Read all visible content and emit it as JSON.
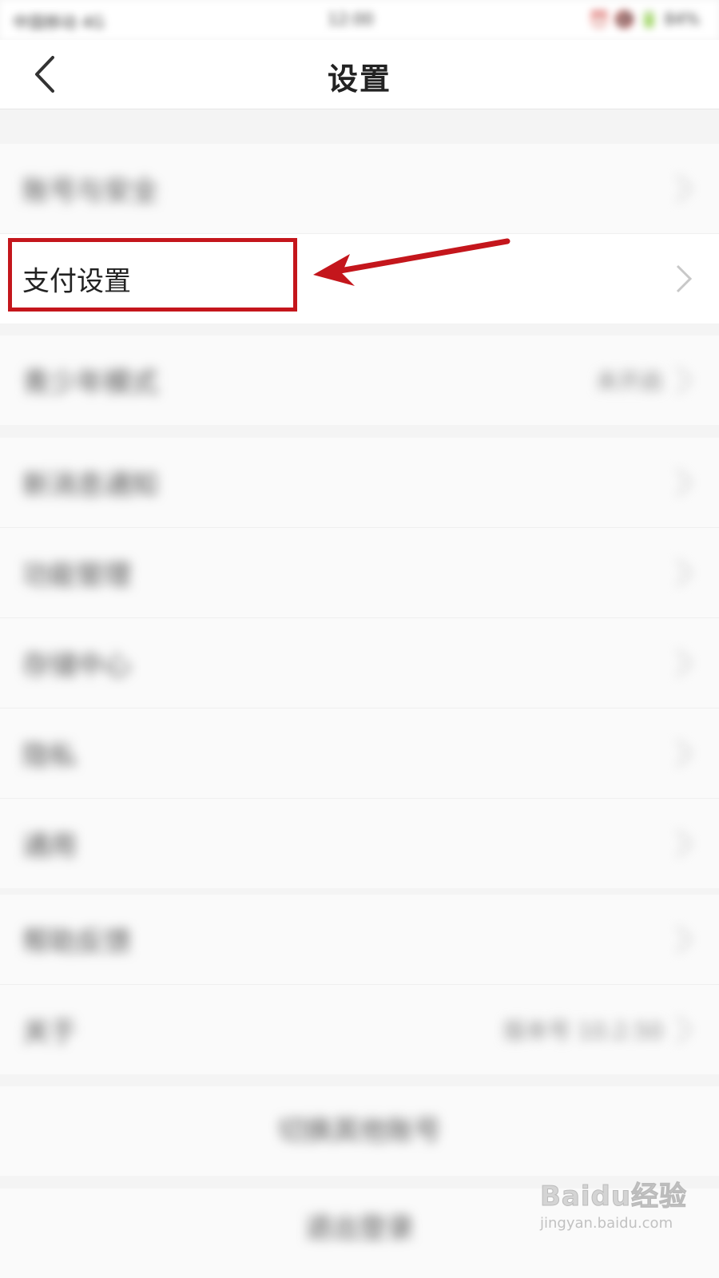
{
  "status_bar": {
    "left": "中国移动 4G",
    "time": "12:00",
    "right": "⏰ 🔇 🔋 84%"
  },
  "nav": {
    "title": "设置"
  },
  "sections": [
    {
      "rows": [
        {
          "label": "账号与安全",
          "value": "",
          "highlighted": false
        },
        {
          "label": "支付设置",
          "value": "",
          "highlighted": true
        }
      ]
    },
    {
      "rows": [
        {
          "label": "青少年模式",
          "value": "未开启",
          "highlighted": false
        }
      ]
    },
    {
      "rows": [
        {
          "label": "新消息通知",
          "value": ""
        },
        {
          "label": "功能管理",
          "value": ""
        },
        {
          "label": "存储中心",
          "value": ""
        },
        {
          "label": "隐私",
          "value": ""
        },
        {
          "label": "通用",
          "value": ""
        }
      ]
    },
    {
      "rows": [
        {
          "label": "帮助反馈",
          "value": ""
        },
        {
          "label": "关于",
          "value": "版本号 10.2.50"
        }
      ]
    }
  ],
  "buttons": {
    "switch_account": "切换其他账号",
    "logout": "退出登录"
  },
  "watermark": {
    "logo": "Baidu经验",
    "url": "jingyan.baidu.com"
  },
  "colors": {
    "annotation": "#c4161c",
    "background": "#f4f4f4",
    "row": "#fafafa"
  }
}
